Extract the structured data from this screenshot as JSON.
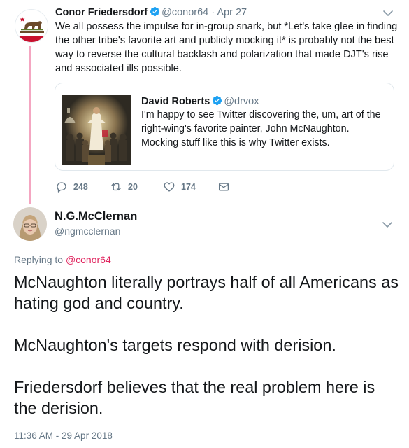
{
  "parent_tweet": {
    "author_name": "Conor Friedersdorf",
    "handle": "@conor64",
    "separator": "·",
    "date": "Apr 27",
    "avatar_caption": "CALIFORNIA REPUBLIC",
    "text": "We all possess the impulse for in-group snark, but *Let's take glee in finding the other tribe's favorite art and publicly mocking it* is probably not the best way to reverse the cultural backlash and polarization that made DJT's rise and associated ills possible.",
    "quoted": {
      "author_name": "David Roberts",
      "handle": "@drvox",
      "text": "I'm happy to see Twitter discovering the, um, art of the right-wing's favorite painter, John McNaughton. Mocking stuff like this is why Twitter exists."
    },
    "actions": {
      "replies": "248",
      "retweets": "20",
      "likes": "174"
    }
  },
  "reply_tweet": {
    "author_name": "N.G.McClernan",
    "handle": "@ngmcclernan",
    "replying_prefix": "Replying to",
    "replying_to": "@conor64",
    "paragraphs": [
      "McNaughton literally portrays half of all Americans as hating god and country.",
      "McNaughton's targets respond with derision.",
      "Friedersdorf believes that the real problem here is the derision."
    ],
    "timestamp": "11:36 AM - 29 Apr 2018"
  },
  "colors": {
    "text": "#14171a",
    "secondary": "#657786",
    "verified": "#1da1f2",
    "thread_line": "#f4a6c1",
    "link": "#e0245e",
    "border": "#e1e8ed"
  }
}
